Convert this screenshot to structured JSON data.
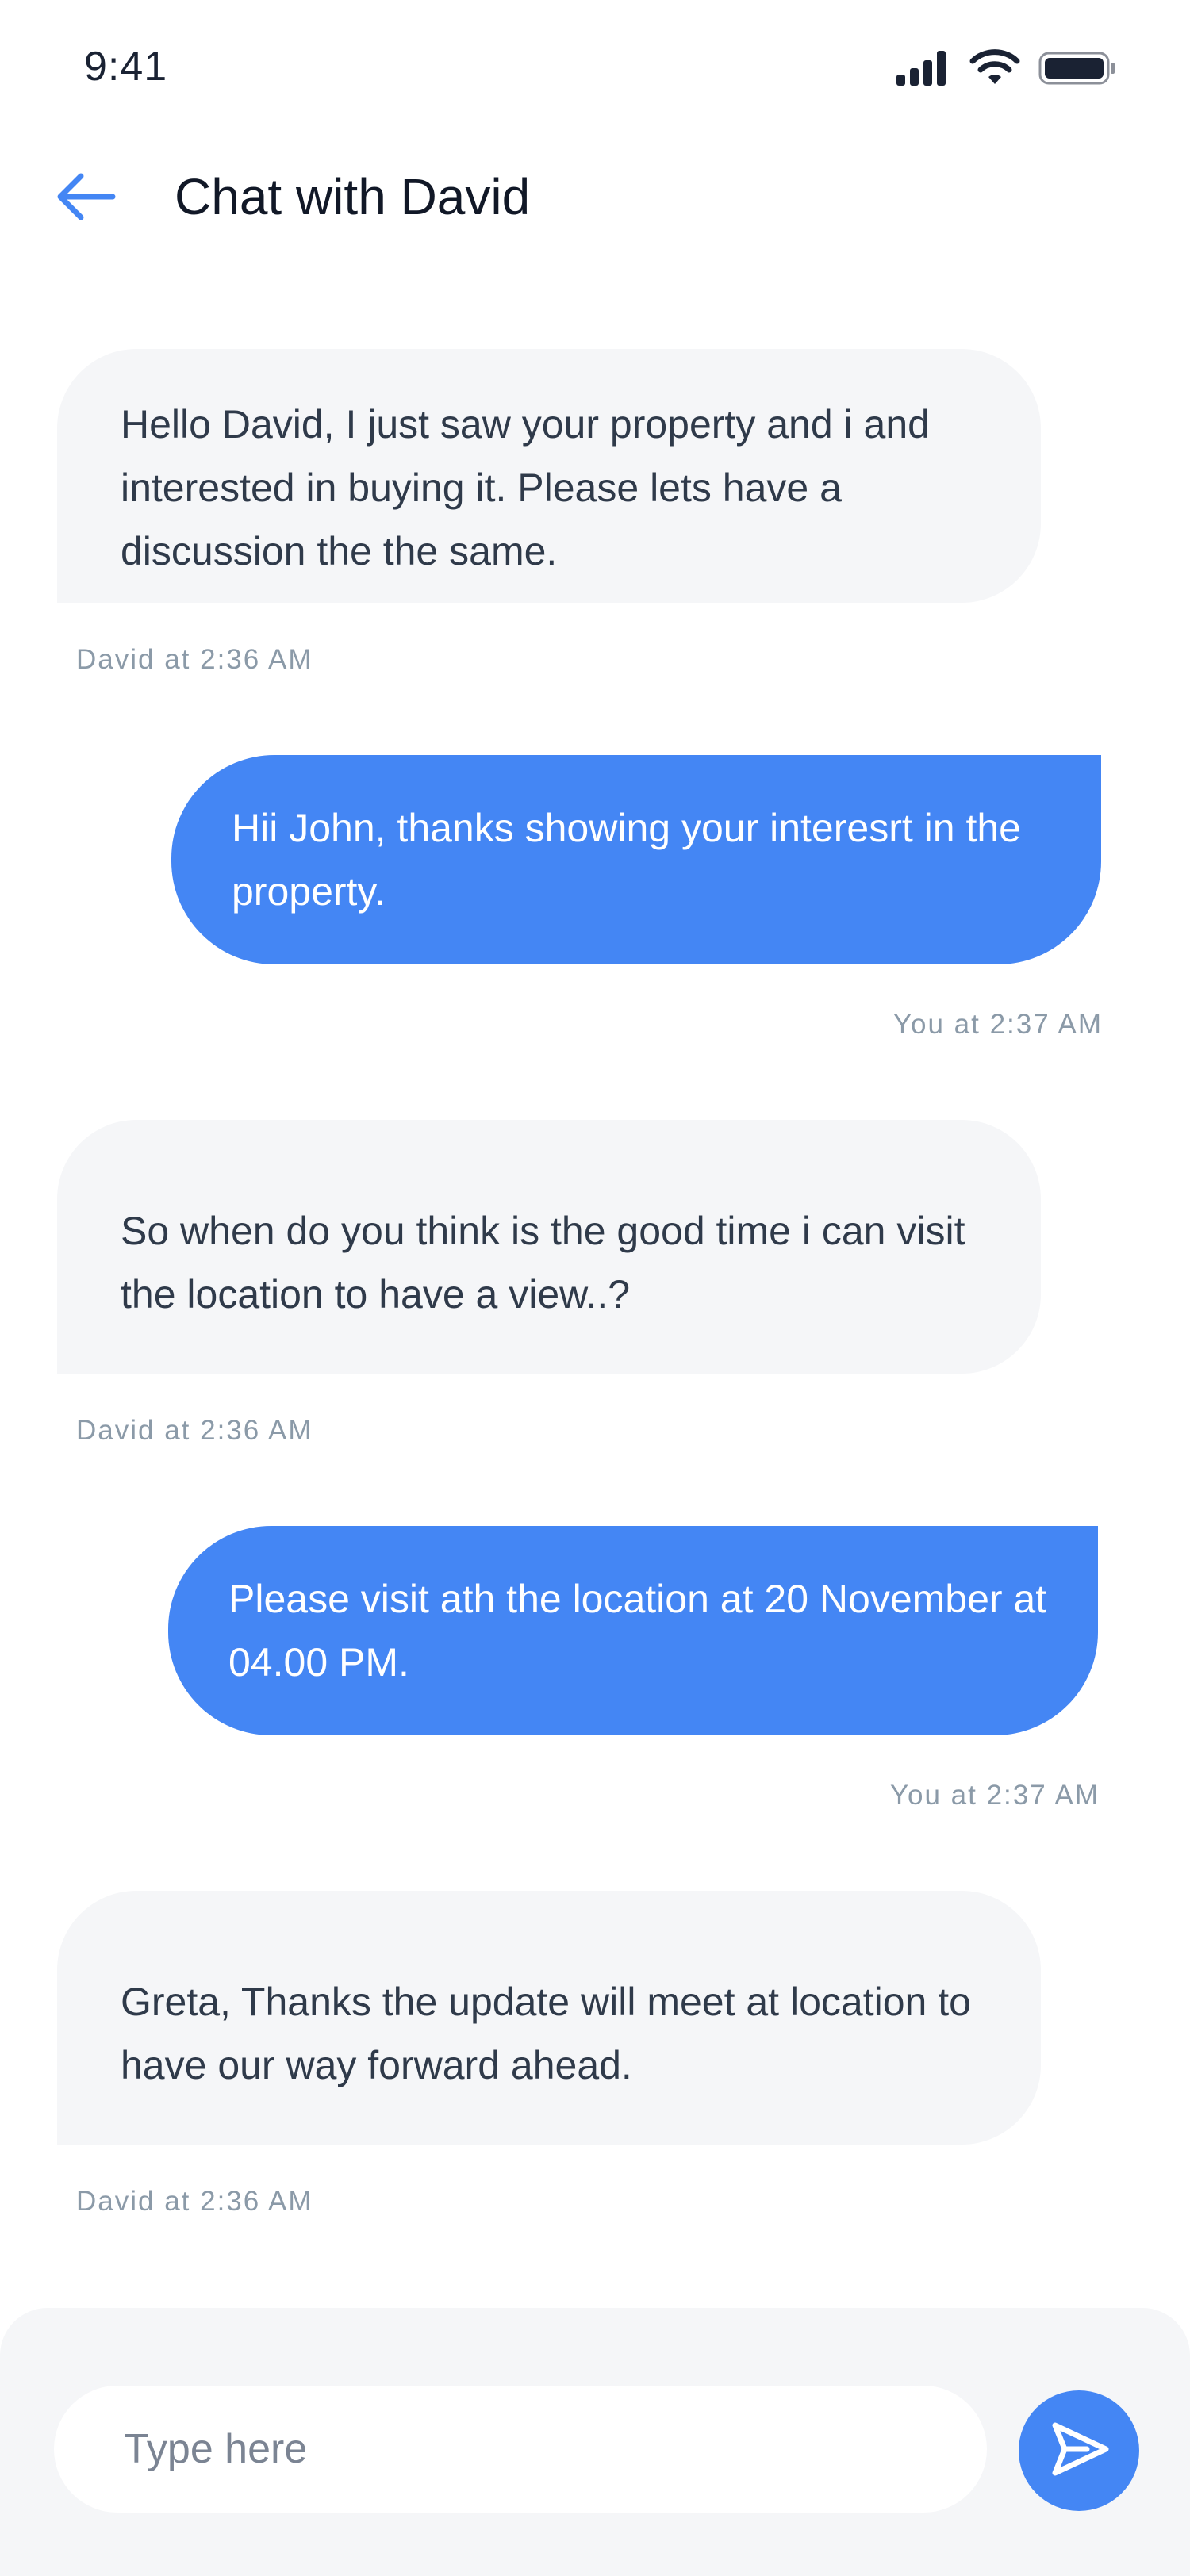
{
  "status_bar": {
    "time": "9:41"
  },
  "header": {
    "title": "Chat with David",
    "back_icon": "arrow-left-icon"
  },
  "messages": [
    {
      "sender": "David",
      "direction": "incoming",
      "text": "Hello David, I just saw your property and i and interested in buying it. Please lets have a discussion the the same.",
      "stamp": "David at 2:36 AM"
    },
    {
      "sender": "You",
      "direction": "outgoing",
      "text": "Hii John, thanks showing your interesrt in the property.",
      "stamp": "You at 2:37 AM"
    },
    {
      "sender": "David",
      "direction": "incoming",
      "text": "So when do you think is the good time i can visit the location to have a view..?",
      "stamp": "David at 2:36 AM"
    },
    {
      "sender": "You",
      "direction": "outgoing",
      "text": "Please visit ath the location at 20 November at 04.00 PM.",
      "stamp": "You at 2:37 AM"
    },
    {
      "sender": "David",
      "direction": "incoming",
      "text": "Greta, Thanks the update will meet at location to have our way forward ahead.",
      "stamp": "David at 2:36 AM"
    }
  ],
  "composer": {
    "placeholder": "Type here",
    "value": "",
    "send_icon": "send-icon"
  },
  "colors": {
    "accent": "#4486f4",
    "incoming_bubble": "#f5f6f8",
    "stamp_text": "#8b9aa8"
  }
}
